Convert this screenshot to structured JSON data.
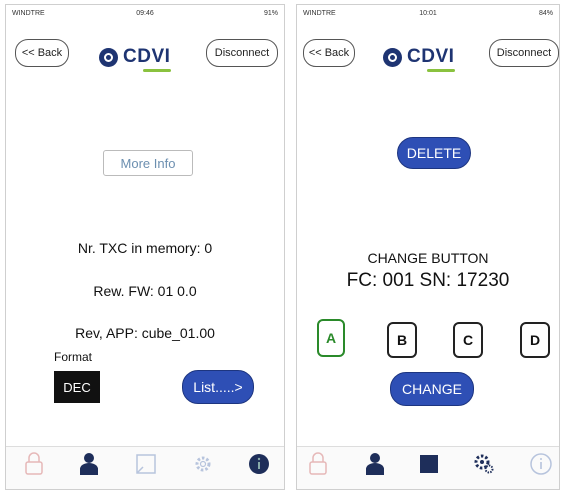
{
  "left": {
    "status": {
      "carrier": "WINDTRE",
      "time": "09:46",
      "battery": "91%"
    },
    "back_label": "<< Back",
    "brand": "CDVI",
    "disconnect_label": "Disconnect",
    "more_info_label": "More Info",
    "txc_text": "Nr. TXC in memory: 0",
    "fw_text": "Rew. FW: 01 0.0",
    "app_text": "Rev, APP: cube_01.00",
    "format_label": "Format",
    "format_value": "DEC",
    "list_label": "List.....>",
    "tabs": [
      {
        "icon": "lock-icon",
        "active": false
      },
      {
        "icon": "person-icon",
        "active": true
      },
      {
        "icon": "square-icon",
        "active": false
      },
      {
        "icon": "gear-icon",
        "active": false
      },
      {
        "icon": "info-icon",
        "active": true
      }
    ]
  },
  "right": {
    "status": {
      "carrier": "WINDTRE",
      "time": "10:01",
      "battery": "84%"
    },
    "back_label": "<< Back",
    "brand": "CDVI",
    "disconnect_label": "Disconnect",
    "delete_label": "DELETE",
    "change_button_title": "CHANGE BUTTON",
    "fc_sn_text": "FC: 001  SN: 17230",
    "buttons": [
      "A",
      "B",
      "C",
      "D"
    ],
    "change_label": "CHANGE",
    "tabs": [
      {
        "icon": "lock-icon",
        "active": false
      },
      {
        "icon": "person-icon",
        "active": true
      },
      {
        "icon": "square-icon",
        "active": true
      },
      {
        "icon": "gear-icon",
        "active": true
      },
      {
        "icon": "info-icon",
        "active": false
      }
    ]
  },
  "colors": {
    "brand_blue": "#1e3472",
    "button_blue": "#2e4fb5",
    "accent_green": "#2a8a2a"
  }
}
